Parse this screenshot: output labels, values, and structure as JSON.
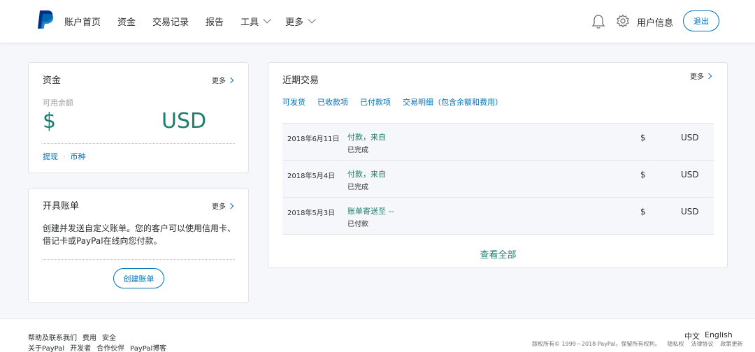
{
  "header": {
    "logo": "paypal-logo",
    "nav": [
      {
        "label": "账户首页",
        "dropdown": false
      },
      {
        "label": "资金",
        "dropdown": false
      },
      {
        "label": "交易记录",
        "dropdown": false
      },
      {
        "label": "报告",
        "dropdown": false
      },
      {
        "label": "工具",
        "dropdown": true
      },
      {
        "label": "更多",
        "dropdown": true
      }
    ],
    "user_label": "用户信息",
    "logout_label": "退出"
  },
  "funds": {
    "title": "资金",
    "more_label": "更多",
    "balance_label": "可用余额",
    "currency_symbol": "$",
    "currency_code": "USD",
    "links": [
      "提现",
      "币种"
    ]
  },
  "invoice": {
    "title": "开具账单",
    "more_label": "更多",
    "description": "创建并发送自定义账单。您的客户可以使用信用卡、借记卡或PayPal在线向您付款。",
    "button_label": "创建账单"
  },
  "transactions": {
    "title": "近期交易",
    "more_label": "更多",
    "filters": [
      "可发货",
      "已收款项",
      "已付款项",
      "交易明细（包含余额和费用）"
    ],
    "rows": [
      {
        "date": "2018年6月11日",
        "description": "付款，来自",
        "status": "已完成",
        "symbol": "$",
        "currency": "USD"
      },
      {
        "date": "2018年5月4日",
        "description": "付款，来自",
        "status": "已完成",
        "symbol": "$",
        "currency": "USD"
      },
      {
        "date": "2018年5月3日",
        "description": "账单寄送至 --",
        "status": "已付款",
        "symbol": "$",
        "currency": "USD"
      }
    ],
    "view_all_label": "查看全部"
  },
  "footer": {
    "row1": [
      "帮助及联系我们",
      "费用",
      "安全"
    ],
    "row2": [
      "关于PayPal",
      "开发者",
      "合作伙伴",
      "PayPal博客"
    ],
    "languages": [
      "中文",
      "English"
    ],
    "copyright": "版权所有© 1999－2018 PayPal。保留所有权利。",
    "legal_links": [
      "隐私权",
      "法律协议",
      "政策更新"
    ]
  },
  "colors": {
    "brand_blue": "#0070ba",
    "accent_green": "#1b7f6b",
    "background": "#f5f7fa"
  }
}
